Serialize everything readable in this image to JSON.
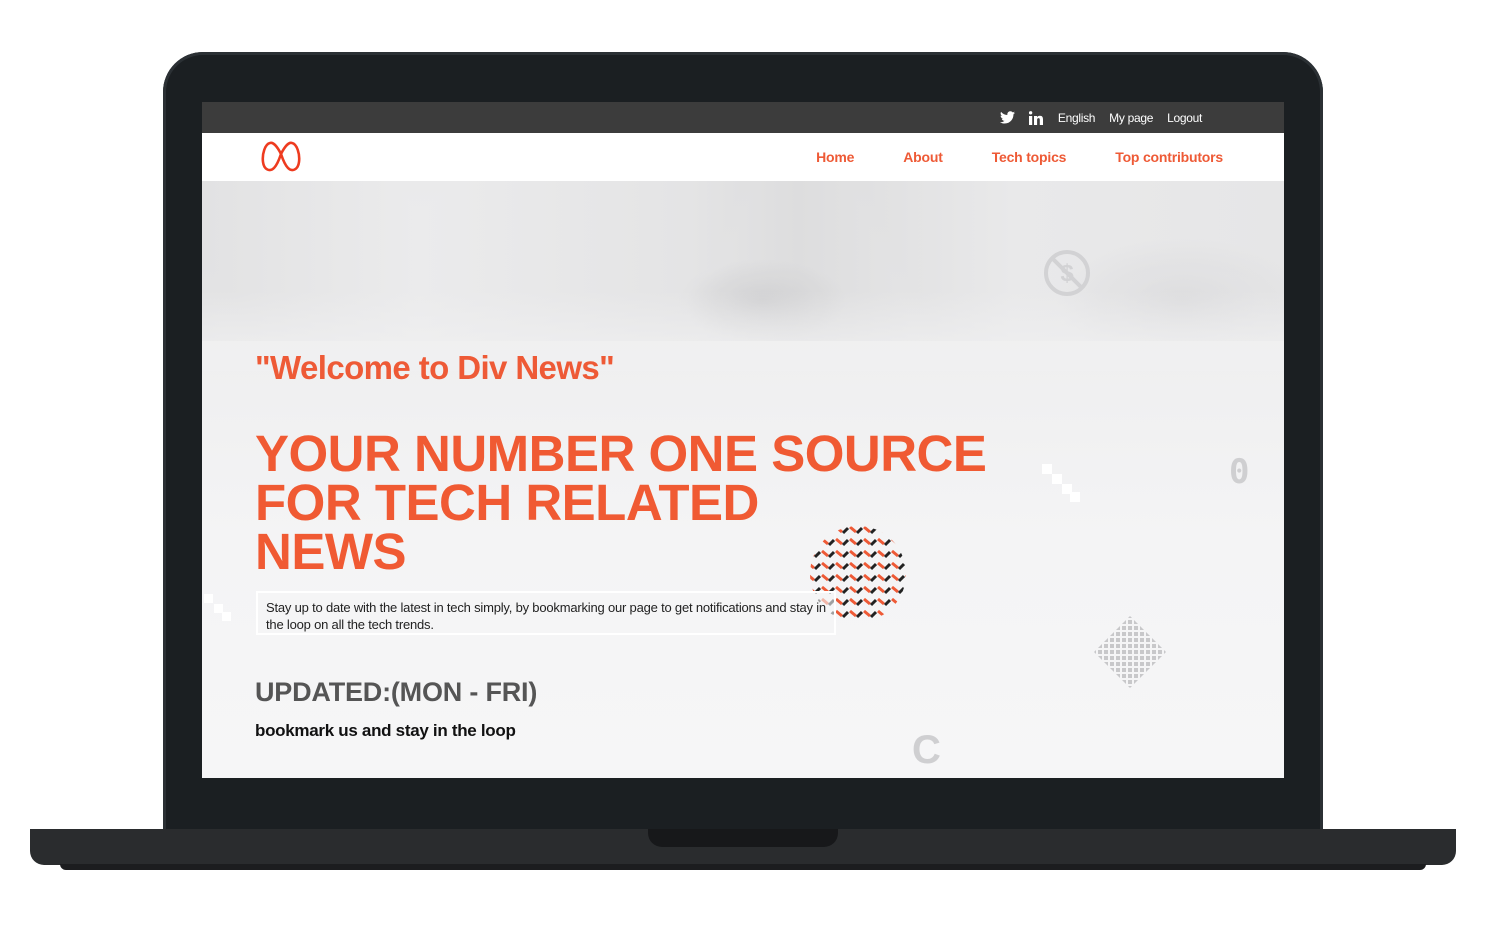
{
  "topbar": {
    "icons": [
      "twitter-icon",
      "linkedin-icon"
    ],
    "links": [
      "English",
      "My page",
      "Logout"
    ]
  },
  "nav": {
    "links": [
      "Home",
      "About",
      "Tech topics",
      "Top contributors"
    ]
  },
  "hero": {
    "welcome": "\"Welcome to Div News\"",
    "headline_line1": "YOUR NUMBER ONE SOURCE",
    "headline_line2": "FOR TECH RELATED",
    "headline_line3": "NEWS",
    "tagline": "Stay up to date with the latest in tech simply, by bookmarking our page to get notifications and stay in the loop on all the tech trends.",
    "updated": "UPDATED:(MON - FRI)",
    "bookmark": "bookmark us and stay in the loop",
    "deco_glyphs": [
      "0",
      "C"
    ]
  },
  "colors": {
    "accent": "#ee5a36",
    "topbar": "#3c3c3c",
    "frame": "#1b1f22"
  }
}
